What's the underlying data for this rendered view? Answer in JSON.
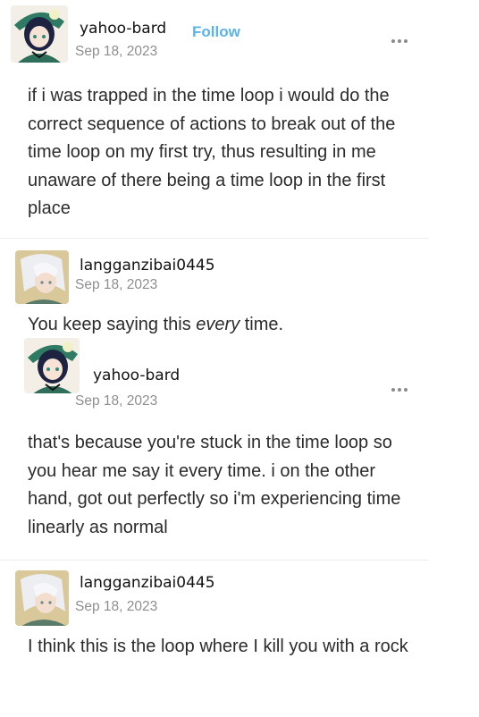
{
  "posts": [
    {
      "author": "yahoo-bard",
      "date": "Sep 18, 2023",
      "follow_label": "Follow",
      "text": "if i was trapped in the time loop i would do the correct sequence of actions to break out of the time loop on my first try, thus resulting in me unaware of there being a time loop in the first place"
    },
    {
      "author": "langganzibai0445",
      "date": "Sep 18, 2023",
      "text_before": "You keep saying this ",
      "text_emph": "every",
      "text_after": " time."
    },
    {
      "author": "yahoo-bard",
      "date": "Sep 18, 2023",
      "text": "that's because you're stuck in the time loop so you hear me say it every time. i on the other hand, got out perfectly so i'm experiencing time linearly as normal"
    },
    {
      "author": "langganzibai0445",
      "date": "Sep 18, 2023",
      "text": "I think this is the loop where I kill you with a rock"
    }
  ],
  "colors": {
    "follow": "#5bb3e8",
    "date": "#8e8e8e",
    "text": "#2b2b2b"
  },
  "icons": {
    "more": "more-options-icon",
    "avatar_bard": "green-hat-character-avatar",
    "avatar_other": "white-hair-character-avatar"
  }
}
